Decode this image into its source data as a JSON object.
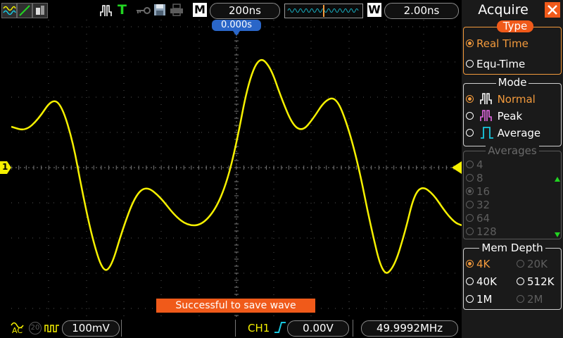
{
  "topbar": {
    "trigger_mode": "T",
    "m_label": "M",
    "time_base": "200ns",
    "w_label": "W",
    "window_scale": "2.00ns",
    "trigger_position": "0.000s"
  },
  "panel": {
    "title": "Acquire",
    "type_legend": "Type",
    "type_options": [
      "Real Time",
      "Equ-Time"
    ],
    "mode_legend": "Mode",
    "mode_options": [
      "Normal",
      "Peak",
      "Average"
    ],
    "averages_legend": "Averages",
    "averages_options": [
      "4",
      "8",
      "16",
      "32",
      "64",
      "128"
    ],
    "memdepth_legend": "Mem Depth",
    "memdepth_options": [
      "4K",
      "20K",
      "40K",
      "512K",
      "1M",
      "2M"
    ]
  },
  "screen": {
    "channel_marker": "1",
    "message": "Successful to save wave"
  },
  "bottombar": {
    "coupling": "AC",
    "bw_label": "20",
    "volts_div": "100mV",
    "trigger_channel": "CH1",
    "trigger_level": "0.00V",
    "frequency": "49.9992MHz"
  },
  "colors": {
    "trace": "#f5f000",
    "accent": "#f39a3c",
    "cyan": "#18c8e0",
    "green": "#22d422"
  }
}
